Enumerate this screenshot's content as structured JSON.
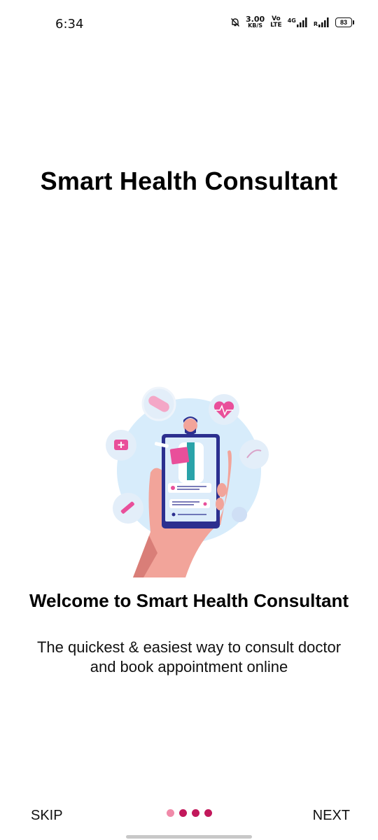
{
  "status_bar": {
    "time": "6:34",
    "net_speed_value": "3.00",
    "net_speed_unit": "KB/S",
    "volte_top": "Vo",
    "volte_bottom": "LTE",
    "network": "4G",
    "roaming": "R",
    "battery": "83"
  },
  "header": {
    "title": "Smart Health Consultant"
  },
  "onboarding": {
    "title": "Welcome to Smart Health Consultant",
    "description": "The quickest & easiest way to consult doctor and book appointment online"
  },
  "nav": {
    "skip_label": "SKIP",
    "next_label": "NEXT",
    "page_count": 4,
    "active_page": 1,
    "dot_active_color": "#f08aa9",
    "dot_inactive_color": "#c2185b"
  },
  "colors": {
    "illustration_circle": "#d7ecfb",
    "phone_frame": "#2c2f8f",
    "accent_pink": "#e94f9a",
    "skin": "#f2a49a"
  }
}
